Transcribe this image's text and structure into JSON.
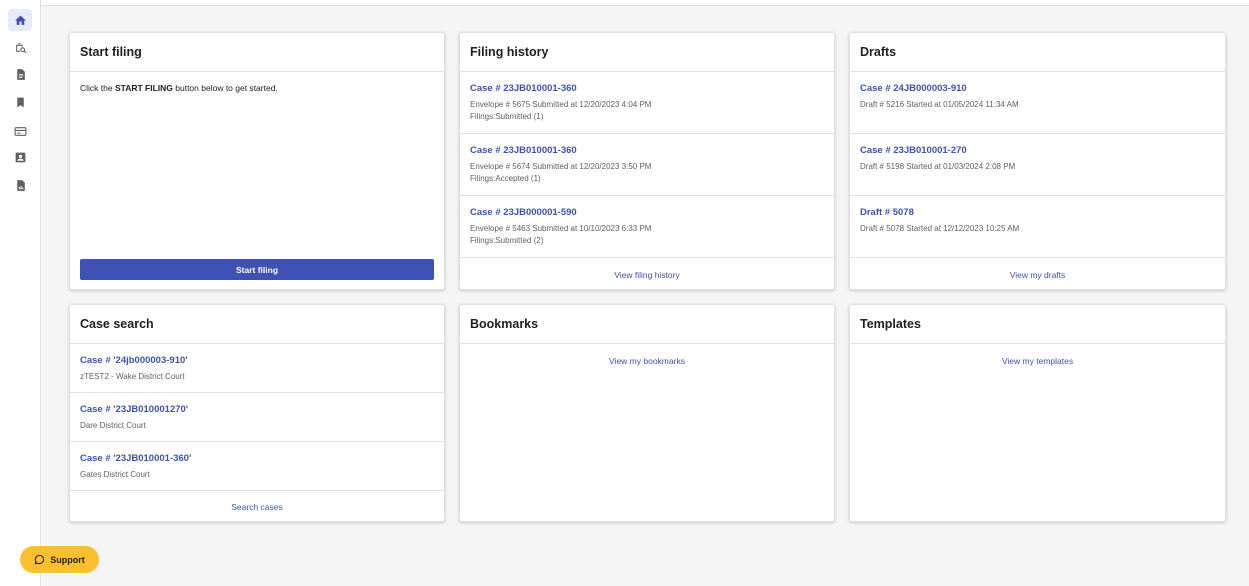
{
  "sidebar": {
    "items": [
      {
        "icon": "home-icon",
        "active": true
      },
      {
        "icon": "case-search-icon",
        "active": false
      },
      {
        "icon": "document-icon",
        "active": false
      },
      {
        "icon": "bookmark-icon",
        "active": false
      },
      {
        "icon": "card-icon",
        "active": false
      },
      {
        "icon": "contact-icon",
        "active": false
      },
      {
        "icon": "report-icon",
        "active": false
      }
    ]
  },
  "start_filing": {
    "title": "Start filing",
    "intro_prefix": "Click the ",
    "intro_bold": "START FILING",
    "intro_suffix": " button below to get started.",
    "button_label": "Start filing"
  },
  "filing_history": {
    "title": "Filing history",
    "items": [
      {
        "case": "Case # 23JB010001-360",
        "detail": "Envelope # 5675 Submitted at 12/20/2023 4:04 PM",
        "status": "Filings:Submitted (1)"
      },
      {
        "case": "Case # 23JB010001-360",
        "detail": "Envelope # 5674 Submitted at 12/20/2023 3:50 PM",
        "status": "Filings:Accepted (1)"
      },
      {
        "case": "Case # 23JB000001-590",
        "detail": "Envelope # 5463 Submitted at 10/10/2023 6:33 PM",
        "status": "Filings:Submitted (2)"
      }
    ],
    "footer_link": "View filing history"
  },
  "drafts": {
    "title": "Drafts",
    "items": [
      {
        "case": "Case # 24JB000003-910",
        "detail": "Draft # 5216 Started at 01/05/2024 11:34 AM"
      },
      {
        "case": "Case # 23JB010001-270",
        "detail": "Draft # 5198 Started at 01/03/2024 2:08 PM"
      },
      {
        "case": "Draft # 5078",
        "detail": "Draft # 5078 Started at 12/12/2023 10:25 AM"
      }
    ],
    "footer_link": "View my drafts"
  },
  "case_search": {
    "title": "Case search",
    "items": [
      {
        "case": "Case # '24jb000003-910'",
        "court": "zTEST2 - Wake District Court"
      },
      {
        "case": "Case # '23JB010001270'",
        "court": "Dare District Court"
      },
      {
        "case": "Case # '23JB010001-360'",
        "court": "Gates District Court"
      }
    ],
    "footer_link": "Search cases"
  },
  "bookmarks": {
    "title": "Bookmarks",
    "link": "View my bookmarks"
  },
  "templates": {
    "title": "Templates",
    "link": "View my templates"
  },
  "support": {
    "label": "Support"
  },
  "colors": {
    "primary": "#3f51b5",
    "support": "#fbc02d",
    "active_nav": "#e8eaf6"
  }
}
